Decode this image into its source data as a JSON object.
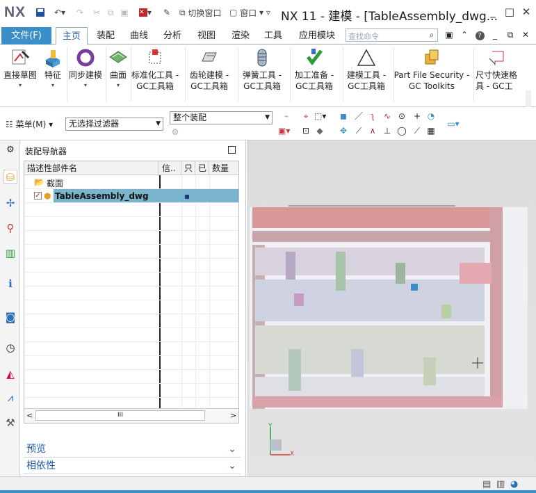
{
  "app": {
    "logo": "NX",
    "title": "NX 11 - 建模 - [TableAssembly_dwg...",
    "quick_access": {
      "switch_window": "切换窗口",
      "window": "窗口"
    }
  },
  "menu": {
    "file": "文件(F)",
    "tabs": [
      "主页",
      "装配",
      "曲线",
      "分析",
      "视图",
      "渲染",
      "工具",
      "应用模块"
    ],
    "search_placeholder": "查找命令"
  },
  "ribbon": {
    "buttons": [
      {
        "label1": "直接草图",
        "label2": ""
      },
      {
        "label1": "特征",
        "label2": ""
      },
      {
        "label1": "同步建模",
        "label2": ""
      },
      {
        "label1": "曲面",
        "label2": ""
      },
      {
        "label1": "标准化工具 -",
        "label2": "GC工具箱"
      },
      {
        "label1": "齿轮建模 -",
        "label2": "GC工具箱"
      },
      {
        "label1": "弹簧工具 -",
        "label2": "GC工具箱"
      },
      {
        "label1": "加工准备 -",
        "label2": "GC工具箱"
      },
      {
        "label1": "建模工具 -",
        "label2": "GC工具箱"
      },
      {
        "label1": "Part File Security -",
        "label2": "GC Toolkits"
      },
      {
        "label1": "尺寸快速格",
        "label2": "具 - GC工"
      }
    ]
  },
  "toolbar": {
    "menu_label": "菜单(M)",
    "filter_value": "无选择过滤器",
    "scope_value": "整个装配"
  },
  "navigator": {
    "title": "装配导航器",
    "columns": [
      "描述性部件名",
      "信..",
      "只",
      "已",
      "数量"
    ],
    "rows": [
      {
        "name": "截面",
        "type": "folder"
      },
      {
        "name": "TableAssembly_dwg",
        "type": "assembly",
        "selected": true
      }
    ],
    "scroll_mid": "III",
    "sections": [
      "预览",
      "相依性"
    ]
  },
  "viewport": {
    "axis_y": "Y",
    "axis_x": "X"
  },
  "colors": {
    "accent": "#3a8fc8",
    "selection": "#7ab3cc",
    "viewport_bg": "#dfdfdf"
  }
}
